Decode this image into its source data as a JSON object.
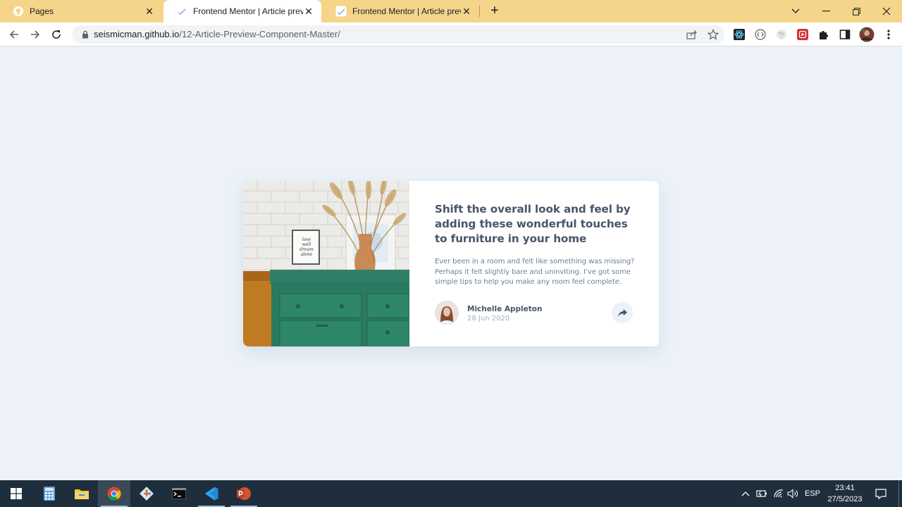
{
  "browser": {
    "tabs": [
      {
        "title": "Pages",
        "favicon": "github-icon",
        "active": false
      },
      {
        "title": "Frontend Mentor | Article previe",
        "favicon": "frontend-mentor-icon",
        "active": true
      },
      {
        "title": "Frontend Mentor | Article previe",
        "favicon": "frontend-mentor-icon",
        "active": false
      }
    ],
    "address": {
      "domain": "seismicman.github.io",
      "path": "/12-Article-Preview-Component-Master/"
    }
  },
  "article": {
    "headline": "Shift the overall look and feel by adding these wonderful touches to furniture in your home",
    "description": "Ever been in a room and felt like something was missing? Perhaps it felt slightly bare and uninviting. I’ve got some simple tips to help you make any room feel complete.",
    "image": "drawers-photo",
    "frame_text": "love well dream alone",
    "author": {
      "name": "Michelle Appleton",
      "date": "28 Jun 2020"
    }
  },
  "taskbar": {
    "apps": [
      "start-icon",
      "calculator-icon",
      "file-explorer-icon",
      "chrome-icon",
      "git-icon",
      "terminal-icon",
      "vscode-icon",
      "powerpoint-icon"
    ],
    "language": "ESP",
    "time": "23:41",
    "date": "27/5/2023"
  },
  "colors": {
    "page_bg": "#ecf2f8",
    "tabstrip_bg": "#f5d58a",
    "heading": "#48556a",
    "body_text": "#6e8098",
    "muted": "#9eafc2",
    "taskbar_bg": "#1f2e3c"
  }
}
